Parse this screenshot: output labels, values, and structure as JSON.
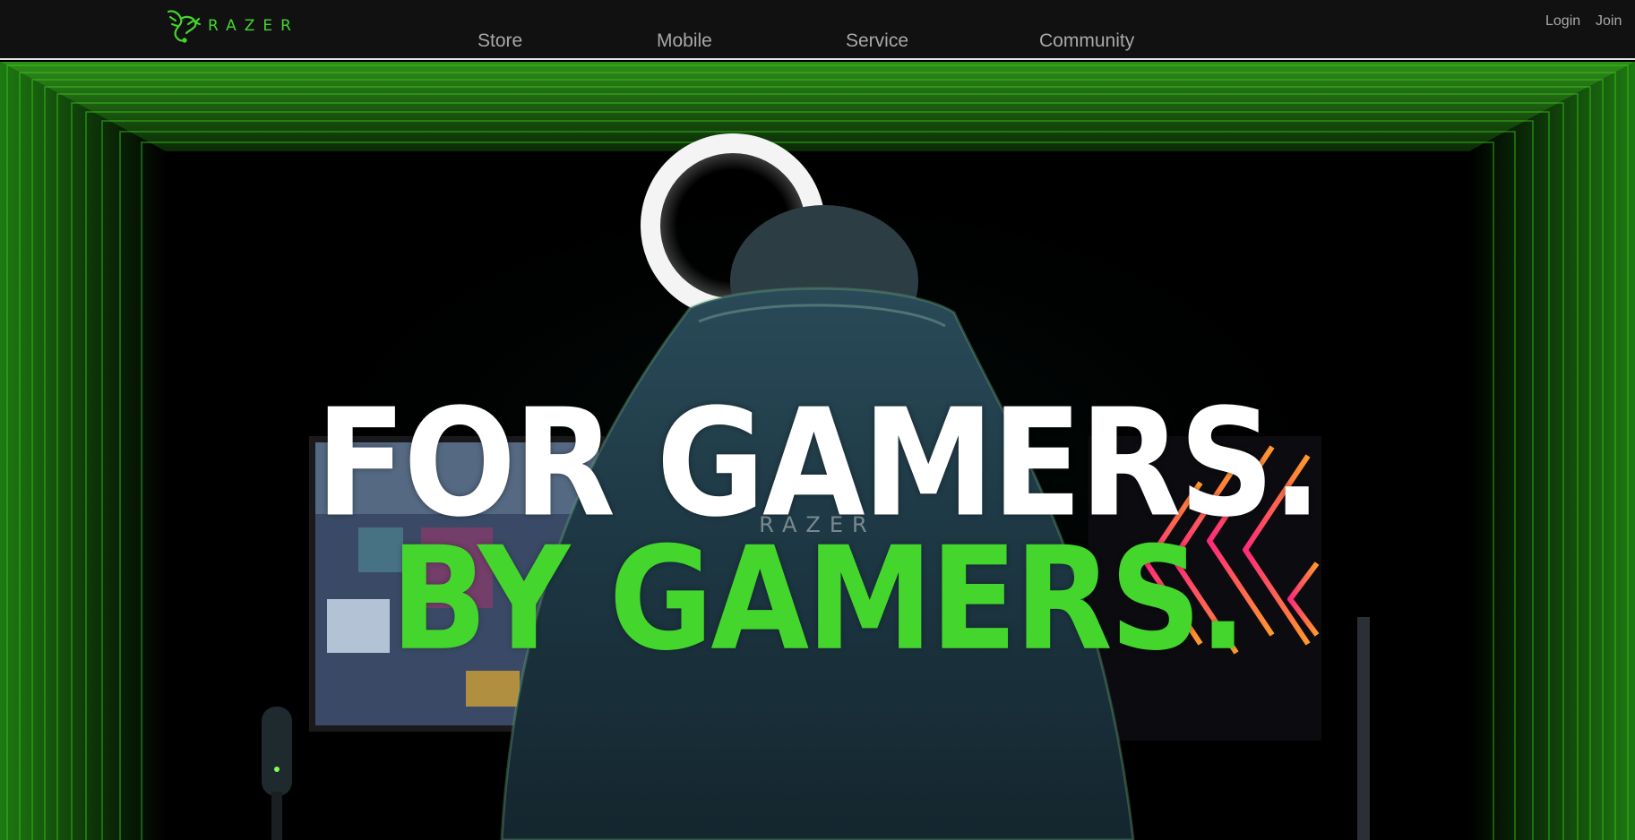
{
  "brand": {
    "logo_icon": "razer-snake-icon",
    "logo_text": "RAZER",
    "accent": "#44d62c"
  },
  "nav": {
    "items": [
      {
        "label": "Store"
      },
      {
        "label": "Mobile"
      },
      {
        "label": "Service"
      },
      {
        "label": "Community"
      }
    ]
  },
  "auth": {
    "login_label": "Login",
    "join_label": "Join"
  },
  "hero": {
    "headline_line1": "FOR GAMERS.",
    "headline_line2": "BY GAMERS.",
    "chair_brand": "RAZER",
    "line1_color": "#ffffff",
    "line2_color": "#44d62c"
  }
}
